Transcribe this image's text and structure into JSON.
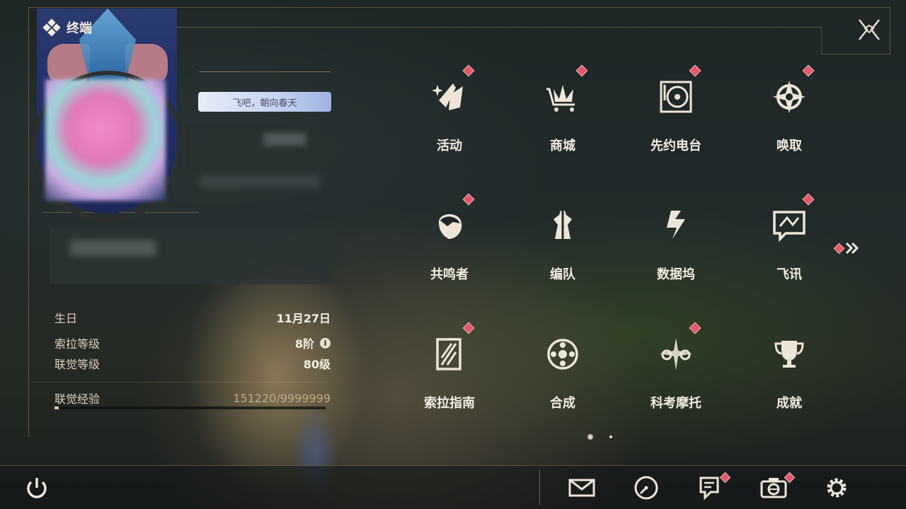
{
  "header": {
    "title": "终端",
    "logo_icon": "diamond-cluster-icon"
  },
  "profile": {
    "slogan": "飞吧，朝向春天",
    "info": [
      {
        "label": "生日",
        "value": "11月27日"
      },
      {
        "label": "索拉等级",
        "value": "8阶",
        "has_info_icon": true
      },
      {
        "label": "联觉等级",
        "value": "80级"
      }
    ],
    "exp": {
      "label": "联觉经验",
      "value": "151220/9999999",
      "progress_fraction": 0.015
    }
  },
  "menu": {
    "items": [
      {
        "label": "活动",
        "icon": "sparkle-activity-icon",
        "badge": true
      },
      {
        "label": "商城",
        "icon": "shop-cart-icon",
        "badge": true
      },
      {
        "label": "先约电台",
        "icon": "radio-record-icon",
        "badge": true
      },
      {
        "label": "唤取",
        "icon": "compass-star-icon",
        "badge": true
      },
      {
        "label": "共鸣者",
        "icon": "character-portrait-icon",
        "badge": true
      },
      {
        "label": "编队",
        "icon": "chess-team-icon",
        "badge": false
      },
      {
        "label": "数据坞",
        "icon": "data-dock-icon",
        "badge": false
      },
      {
        "label": "飞讯",
        "icon": "chat-bubble-icon",
        "badge": true
      },
      {
        "label": "索拉指南",
        "icon": "guide-book-icon",
        "badge": true
      },
      {
        "label": "合成",
        "icon": "synthesis-icon",
        "badge": false
      },
      {
        "label": "科考摩托",
        "icon": "motorbike-icon",
        "badge": true
      },
      {
        "label": "成就",
        "icon": "trophy-icon",
        "badge": false
      }
    ],
    "next_page": {
      "icon": "double-chevron-right-icon",
      "badge": true
    },
    "pages": {
      "total": 2,
      "current": 1
    }
  },
  "bottom_bar": {
    "buttons": [
      {
        "name": "power",
        "icon": "power-icon",
        "badge": false
      },
      {
        "name": "mail",
        "icon": "mail-icon",
        "badge": false
      },
      {
        "name": "clock",
        "icon": "clock-icon",
        "badge": false
      },
      {
        "name": "notice",
        "icon": "notice-icon",
        "badge": true
      },
      {
        "name": "camera",
        "icon": "camera-icon",
        "badge": true
      },
      {
        "name": "settings",
        "icon": "gear-icon",
        "badge": false
      }
    ]
  },
  "close": {
    "icon": "close-icon"
  },
  "colors": {
    "accent_badge": "#e05a68",
    "gold_line": "#c8b482",
    "text": "#ece6d8"
  }
}
